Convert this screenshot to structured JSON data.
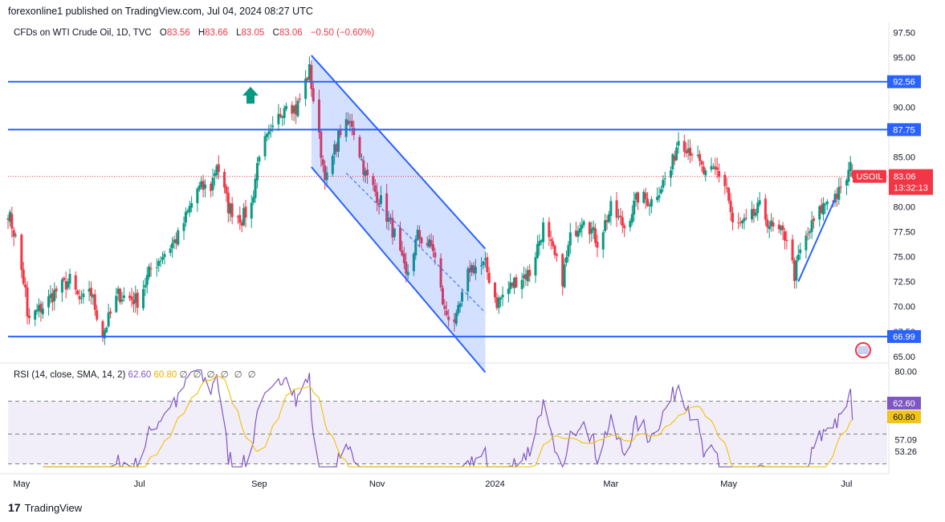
{
  "header": {
    "publisher": "forexonline1 published on TradingView.com, Jul 04, 2024 08:27 UTC"
  },
  "legend": {
    "symbol": "CFDs on WTI Crude Oil, 1D, TVC",
    "open_label": "O",
    "open": "83.56",
    "high_label": "H",
    "high": "83.66",
    "low_label": "L",
    "low": "83.05",
    "close_label": "C",
    "close": "83.06",
    "change": "−0.50 (−0.60%)"
  },
  "rsi_legend": {
    "name": "RSI (14, close, SMA, 14, 2)",
    "rsi_value": "62.60",
    "sma_value": "60.80",
    "icons": "∅∅∅∅∅∅"
  },
  "footer": {
    "brand": "TradingView",
    "logo": "17"
  },
  "colors": {
    "up": "#089981",
    "down": "#f23645",
    "level": "#2962ff",
    "channel_fill": "rgba(41,98,255,0.2)",
    "rsi": "#7e57c2",
    "rsi_sma": "#f0c419",
    "rsi_band": "rgba(126,87,194,0.1)",
    "arrow": "#089981"
  },
  "chart_data": {
    "type": "candlestick",
    "title": "CFDs on WTI Crude Oil, 1D, TVC",
    "price_axis": {
      "ticks": [
        "97.50",
        "95.00",
        "92.50",
        "90.00",
        "87.50",
        "85.00",
        "82.50",
        "80.00",
        "77.50",
        "75.00",
        "72.50",
        "70.00",
        "67.50",
        "65.00"
      ],
      "range": [
        64.5,
        98.5
      ]
    },
    "x_axis": {
      "ticks": [
        "May",
        "Jul",
        "Sep",
        "Nov",
        "2024",
        "Mar",
        "May",
        "Jul"
      ],
      "range": [
        "2023-04-24",
        "2024-07-22"
      ]
    },
    "price_path": [
      [
        "2023-04-24",
        79.5
      ],
      [
        "2023-04-28",
        76.8
      ],
      [
        "2023-05-03",
        71.5
      ],
      [
        "2023-05-04",
        68.6
      ],
      [
        "2023-05-12",
        70.0
      ],
      [
        "2023-05-19",
        71.6
      ],
      [
        "2023-05-26",
        72.6
      ],
      [
        "2023-06-01",
        70.2
      ],
      [
        "2023-06-05",
        72.0
      ],
      [
        "2023-06-12",
        67.2
      ],
      [
        "2023-06-20",
        71.2
      ],
      [
        "2023-06-30",
        70.6
      ],
      [
        "2023-07-07",
        73.8
      ],
      [
        "2023-07-14",
        75.4
      ],
      [
        "2023-07-21",
        77.0
      ],
      [
        "2023-07-31",
        81.8
      ],
      [
        "2023-08-07",
        82.0
      ],
      [
        "2023-08-10",
        84.4
      ],
      [
        "2023-08-16",
        80.0
      ],
      [
        "2023-08-23",
        78.8
      ],
      [
        "2023-08-28",
        80.2
      ],
      [
        "2023-09-01",
        85.6
      ],
      [
        "2023-09-08",
        87.5
      ],
      [
        "2023-09-15",
        90.8
      ],
      [
        "2023-09-20",
        89.7
      ],
      [
        "2023-09-27",
        93.7
      ],
      [
        "2023-09-29",
        90.8
      ],
      [
        "2023-10-04",
        84.2
      ],
      [
        "2023-10-06",
        82.8
      ],
      [
        "2023-10-13",
        87.7
      ],
      [
        "2023-10-19",
        88.4
      ],
      [
        "2023-10-26",
        83.2
      ],
      [
        "2023-11-03",
        80.5
      ],
      [
        "2023-11-10",
        77.2
      ],
      [
        "2023-11-16",
        72.9
      ],
      [
        "2023-11-22",
        77.1
      ],
      [
        "2023-11-30",
        75.8
      ],
      [
        "2023-12-06",
        69.4
      ],
      [
        "2023-12-12",
        68.6
      ],
      [
        "2023-12-19",
        73.9
      ],
      [
        "2023-12-27",
        74.1
      ],
      [
        "2024-01-02",
        70.4
      ],
      [
        "2024-01-12",
        72.7
      ],
      [
        "2024-01-19",
        73.4
      ],
      [
        "2024-01-26",
        78.0
      ],
      [
        "2024-02-05",
        72.8
      ],
      [
        "2024-02-09",
        76.8
      ],
      [
        "2024-02-16",
        79.2
      ],
      [
        "2024-02-23",
        76.5
      ],
      [
        "2024-03-01",
        79.8
      ],
      [
        "2024-03-08",
        78.0
      ],
      [
        "2024-03-15",
        81.0
      ],
      [
        "2024-03-22",
        80.6
      ],
      [
        "2024-04-01",
        83.7
      ],
      [
        "2024-04-05",
        86.9
      ],
      [
        "2024-04-12",
        85.6
      ],
      [
        "2024-04-19",
        83.1
      ],
      [
        "2024-04-25",
        83.6
      ],
      [
        "2024-04-30",
        81.9
      ],
      [
        "2024-05-03",
        78.1
      ],
      [
        "2024-05-10",
        78.3
      ],
      [
        "2024-05-17",
        79.9
      ],
      [
        "2024-05-24",
        77.7
      ],
      [
        "2024-05-31",
        77.0
      ],
      [
        "2024-06-04",
        73.2
      ],
      [
        "2024-06-07",
        75.5
      ],
      [
        "2024-06-14",
        78.5
      ],
      [
        "2024-06-21",
        80.7
      ],
      [
        "2024-06-28",
        81.5
      ],
      [
        "2024-07-03",
        83.9
      ],
      [
        "2024-07-04",
        83.06
      ]
    ],
    "horizontal_levels": [
      {
        "price": 92.56,
        "label": "92.56"
      },
      {
        "price": 87.75,
        "label": "87.75"
      },
      {
        "price": 66.99,
        "label": "66.99"
      }
    ],
    "last_price": {
      "symbol": "USOIL",
      "value": "83.06",
      "countdown": "13:32:13"
    },
    "descending_channel": {
      "upper": [
        [
          "2023-09-28",
          95.2
        ],
        [
          "2023-12-27",
          75.8
        ]
      ],
      "lower": [
        [
          "2023-09-28",
          84.0
        ],
        [
          "2023-12-27",
          63.4
        ]
      ],
      "mid": [
        [
          "2023-10-16",
          83.4
        ],
        [
          "2023-12-27",
          69.4
        ]
      ]
    },
    "trendline": [
      [
        "2024-06-06",
        72.5
      ],
      [
        "2024-06-25",
        80.8
      ]
    ],
    "rsi": {
      "axis_ticks": [
        "80.00",
        "62.60",
        "60.80",
        "57.09",
        "53.26"
      ],
      "range": [
        47,
        81.5
      ],
      "bands": {
        "upper": 70,
        "middle": 59,
        "lower": 49
      },
      "value": 62.6,
      "sma": 60.8
    }
  }
}
